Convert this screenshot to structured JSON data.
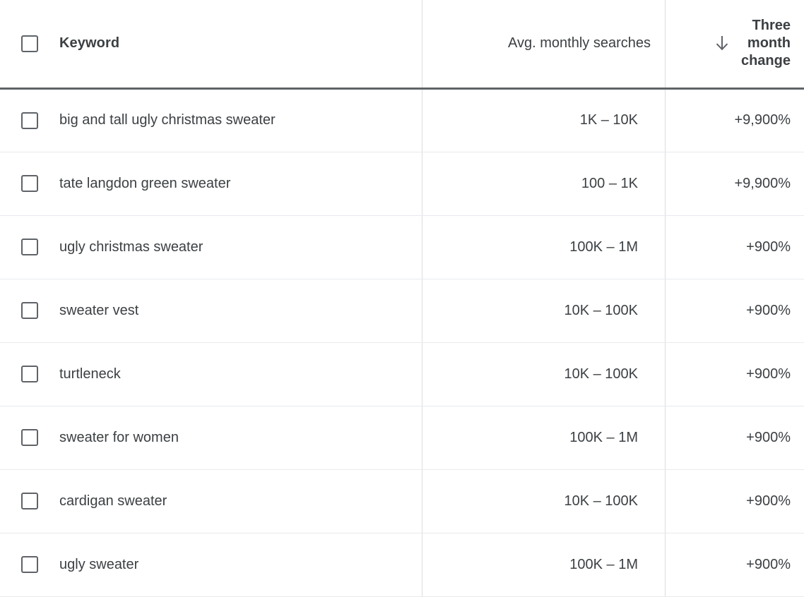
{
  "table": {
    "columns": [
      {
        "id": "keyword",
        "label": "Keyword",
        "align": "left",
        "bold": true,
        "sorted": false
      },
      {
        "id": "searches",
        "label": "Avg. monthly searches",
        "align": "right",
        "bold": false,
        "sorted": false
      },
      {
        "id": "change",
        "label": "Three month change",
        "label_lines": [
          "Three",
          "month",
          "change"
        ],
        "align": "right",
        "bold": true,
        "sorted": true,
        "sort_direction": "descending",
        "sort_icon": "arrow-down-icon"
      }
    ],
    "select_all_checkbox": {
      "icon": "checkbox-unchecked-icon",
      "checked": false
    },
    "rows": [
      {
        "checkbox": {
          "icon": "checkbox-unchecked-icon",
          "checked": false
        },
        "keyword": "big and tall ugly christmas sweater",
        "searches": "1K – 10K",
        "change": "+9,900%"
      },
      {
        "checkbox": {
          "icon": "checkbox-unchecked-icon",
          "checked": false
        },
        "keyword": "tate langdon green sweater",
        "searches": "100 – 1K",
        "change": "+9,900%"
      },
      {
        "checkbox": {
          "icon": "checkbox-unchecked-icon",
          "checked": false
        },
        "keyword": "ugly christmas sweater",
        "searches": "100K – 1M",
        "change": "+900%"
      },
      {
        "checkbox": {
          "icon": "checkbox-unchecked-icon",
          "checked": false
        },
        "keyword": "sweater vest",
        "searches": "10K – 100K",
        "change": "+900%"
      },
      {
        "checkbox": {
          "icon": "checkbox-unchecked-icon",
          "checked": false
        },
        "keyword": "turtleneck",
        "searches": "10K – 100K",
        "change": "+900%"
      },
      {
        "checkbox": {
          "icon": "checkbox-unchecked-icon",
          "checked": false
        },
        "keyword": "sweater for women",
        "searches": "100K – 1M",
        "change": "+900%"
      },
      {
        "checkbox": {
          "icon": "checkbox-unchecked-icon",
          "checked": false
        },
        "keyword": "cardigan sweater",
        "searches": "10K – 100K",
        "change": "+900%"
      },
      {
        "checkbox": {
          "icon": "checkbox-unchecked-icon",
          "checked": false
        },
        "keyword": "ugly sweater",
        "searches": "100K – 1M",
        "change": "+900%"
      }
    ]
  },
  "colors": {
    "text": "#3c4043",
    "border_light": "#e8eaed",
    "border_column": "#dadce0",
    "border_header": "#5f6368",
    "checkbox_border": "#5f6368",
    "background": "#ffffff"
  }
}
